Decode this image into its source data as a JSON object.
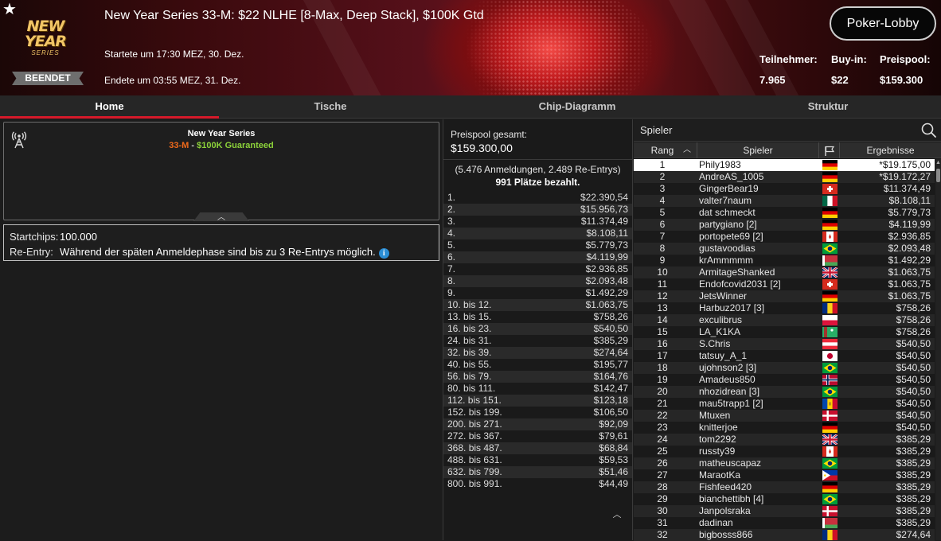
{
  "header": {
    "logo_line1": "NEW YEAR",
    "logo_line2": "SERIES",
    "status_badge": "BEENDET",
    "title": "New Year Series 33-M: $22 NLHE [8-Max, Deep Stack], $100K Gtd",
    "started": "Startete um 17:30 MEZ, 30. Dez.",
    "ended": "Endete um 03:55 MEZ, 31. Dez.",
    "lobby_button": "Poker-Lobby",
    "stats": [
      {
        "label": "Teilnehmer:",
        "value": "7.965"
      },
      {
        "label": "Buy-in:",
        "value": "$22"
      },
      {
        "label": "Preispool:",
        "value": "$159.300"
      }
    ]
  },
  "tabs": [
    "Home",
    "Tische",
    "Chip-Diagramm",
    "Struktur"
  ],
  "info": {
    "series": "New Year Series",
    "code": "33-M",
    "separator": " - ",
    "guarantee": "$100K Guaranteed",
    "startchips_label": "Startchips:",
    "startchips_value": "100.000",
    "reentry_label": "Re-Entry:",
    "reentry_value": "Während der späten Anmeldephase sind bis zu 3 Re-Entrys möglich.",
    "info_icon": "i"
  },
  "prizepool": {
    "label": "Preispool gesamt:",
    "total": "$159.300,00",
    "entries": "(5.476 Anmeldungen, 2.489 Re-Entrys)",
    "paid": "991 Plätze bezahlt.",
    "payouts": [
      {
        "place": "1.",
        "amount": "$22.390,54"
      },
      {
        "place": "2.",
        "amount": "$15.956,73"
      },
      {
        "place": "3.",
        "amount": "$11.374,49"
      },
      {
        "place": "4.",
        "amount": "$8.108,11"
      },
      {
        "place": "5.",
        "amount": "$5.779,73"
      },
      {
        "place": "6.",
        "amount": "$4.119,99"
      },
      {
        "place": "7.",
        "amount": "$2.936,85"
      },
      {
        "place": "8.",
        "amount": "$2.093,48"
      },
      {
        "place": "9.",
        "amount": "$1.492,29"
      },
      {
        "place": "10. bis 12.",
        "amount": "$1.063,75"
      },
      {
        "place": "13. bis 15.",
        "amount": "$758,26"
      },
      {
        "place": "16. bis 23.",
        "amount": "$540,50"
      },
      {
        "place": "24. bis 31.",
        "amount": "$385,29"
      },
      {
        "place": "32. bis 39.",
        "amount": "$274,64"
      },
      {
        "place": "40. bis 55.",
        "amount": "$195,77"
      },
      {
        "place": "56. bis 79.",
        "amount": "$164,76"
      },
      {
        "place": "80. bis 111.",
        "amount": "$142,47"
      },
      {
        "place": "112. bis 151.",
        "amount": "$123,18"
      },
      {
        "place": "152. bis 199.",
        "amount": "$106,50"
      },
      {
        "place": "200. bis 271.",
        "amount": "$92,09"
      },
      {
        "place": "272. bis 367.",
        "amount": "$79,61"
      },
      {
        "place": "368. bis 487.",
        "amount": "$68,84"
      },
      {
        "place": "488. bis 631.",
        "amount": "$59,53"
      },
      {
        "place": "632. bis 799.",
        "amount": "$51,46"
      },
      {
        "place": "800. bis 991.",
        "amount": "$44,49"
      }
    ]
  },
  "players": {
    "search_placeholder": "Spieler",
    "columns": {
      "rank": "Rang",
      "player": "Spieler",
      "results": "Ergebnisse"
    },
    "rows": [
      {
        "rank": "1",
        "name": "Phily1983",
        "flag": "de",
        "result": "*$19.175,00"
      },
      {
        "rank": "2",
        "name": "AndreAS_1005",
        "flag": "de",
        "result": "*$19.172,27"
      },
      {
        "rank": "3",
        "name": "GingerBear19",
        "flag": "ch",
        "result": "$11.374,49"
      },
      {
        "rank": "4",
        "name": "valter7naum",
        "flag": "mx",
        "result": "$8.108,11"
      },
      {
        "rank": "5",
        "name": "dat schmeckt",
        "flag": "de",
        "result": "$5.779,73"
      },
      {
        "rank": "6",
        "name": "partygiano [2]",
        "flag": "de",
        "result": "$4.119,99"
      },
      {
        "rank": "7",
        "name": "portopete69 [2]",
        "flag": "ca",
        "result": "$2.936,85"
      },
      {
        "rank": "8",
        "name": "gustavoodias",
        "flag": "br",
        "result": "$2.093,48"
      },
      {
        "rank": "9",
        "name": "krAmmmmm",
        "flag": "by",
        "result": "$1.492,29"
      },
      {
        "rank": "10",
        "name": "ArmitageShanked",
        "flag": "gb",
        "result": "$1.063,75"
      },
      {
        "rank": "11",
        "name": "Endofcovid2031 [2]",
        "flag": "ch",
        "result": "$1.063,75"
      },
      {
        "rank": "12",
        "name": "JetsWinner",
        "flag": "de",
        "result": "$1.063,75"
      },
      {
        "rank": "13",
        "name": "Harbuz2017 [3]",
        "flag": "ro",
        "result": "$758,26"
      },
      {
        "rank": "14",
        "name": "exculibrus",
        "flag": "pl",
        "result": "$758,26"
      },
      {
        "rank": "15",
        "name": "LA_K1KA",
        "flag": "tm",
        "result": "$758,26"
      },
      {
        "rank": "16",
        "name": "S.Chris",
        "flag": "at",
        "result": "$540,50"
      },
      {
        "rank": "17",
        "name": "tatsuy_A_1",
        "flag": "jp",
        "result": "$540,50"
      },
      {
        "rank": "18",
        "name": "ujohnson2 [3]",
        "flag": "br",
        "result": "$540,50"
      },
      {
        "rank": "19",
        "name": "Amadeus850",
        "flag": "no",
        "result": "$540,50"
      },
      {
        "rank": "20",
        "name": "nhozidrean [3]",
        "flag": "br",
        "result": "$540,50"
      },
      {
        "rank": "21",
        "name": "mau5trapp1 [2]",
        "flag": "md",
        "result": "$540,50"
      },
      {
        "rank": "22",
        "name": "Mtuxen",
        "flag": "dk",
        "result": "$540,50"
      },
      {
        "rank": "23",
        "name": "knitterjoe",
        "flag": "de",
        "result": "$540,50"
      },
      {
        "rank": "24",
        "name": "tom2292",
        "flag": "gb",
        "result": "$385,29"
      },
      {
        "rank": "25",
        "name": "russty39",
        "flag": "ca",
        "result": "$385,29"
      },
      {
        "rank": "26",
        "name": "matheuscapaz",
        "flag": "br",
        "result": "$385,29"
      },
      {
        "rank": "27",
        "name": "MaraotKa",
        "flag": "ph",
        "result": "$385,29"
      },
      {
        "rank": "28",
        "name": "Fishfeed420",
        "flag": "de",
        "result": "$385,29"
      },
      {
        "rank": "29",
        "name": "bianchettibh [4]",
        "flag": "br",
        "result": "$385,29"
      },
      {
        "rank": "30",
        "name": "Janpolsraka",
        "flag": "dk",
        "result": "$385,29"
      },
      {
        "rank": "31",
        "name": "dadinan",
        "flag": "by",
        "result": "$385,29"
      },
      {
        "rank": "32",
        "name": "bigbosss866",
        "flag": "ro",
        "result": "$274,64"
      }
    ]
  },
  "colors": {
    "accent": "#d6192a",
    "code": "#f06a1b",
    "guarantee": "#8cd23a",
    "info_icon": "#2a8dd4"
  }
}
